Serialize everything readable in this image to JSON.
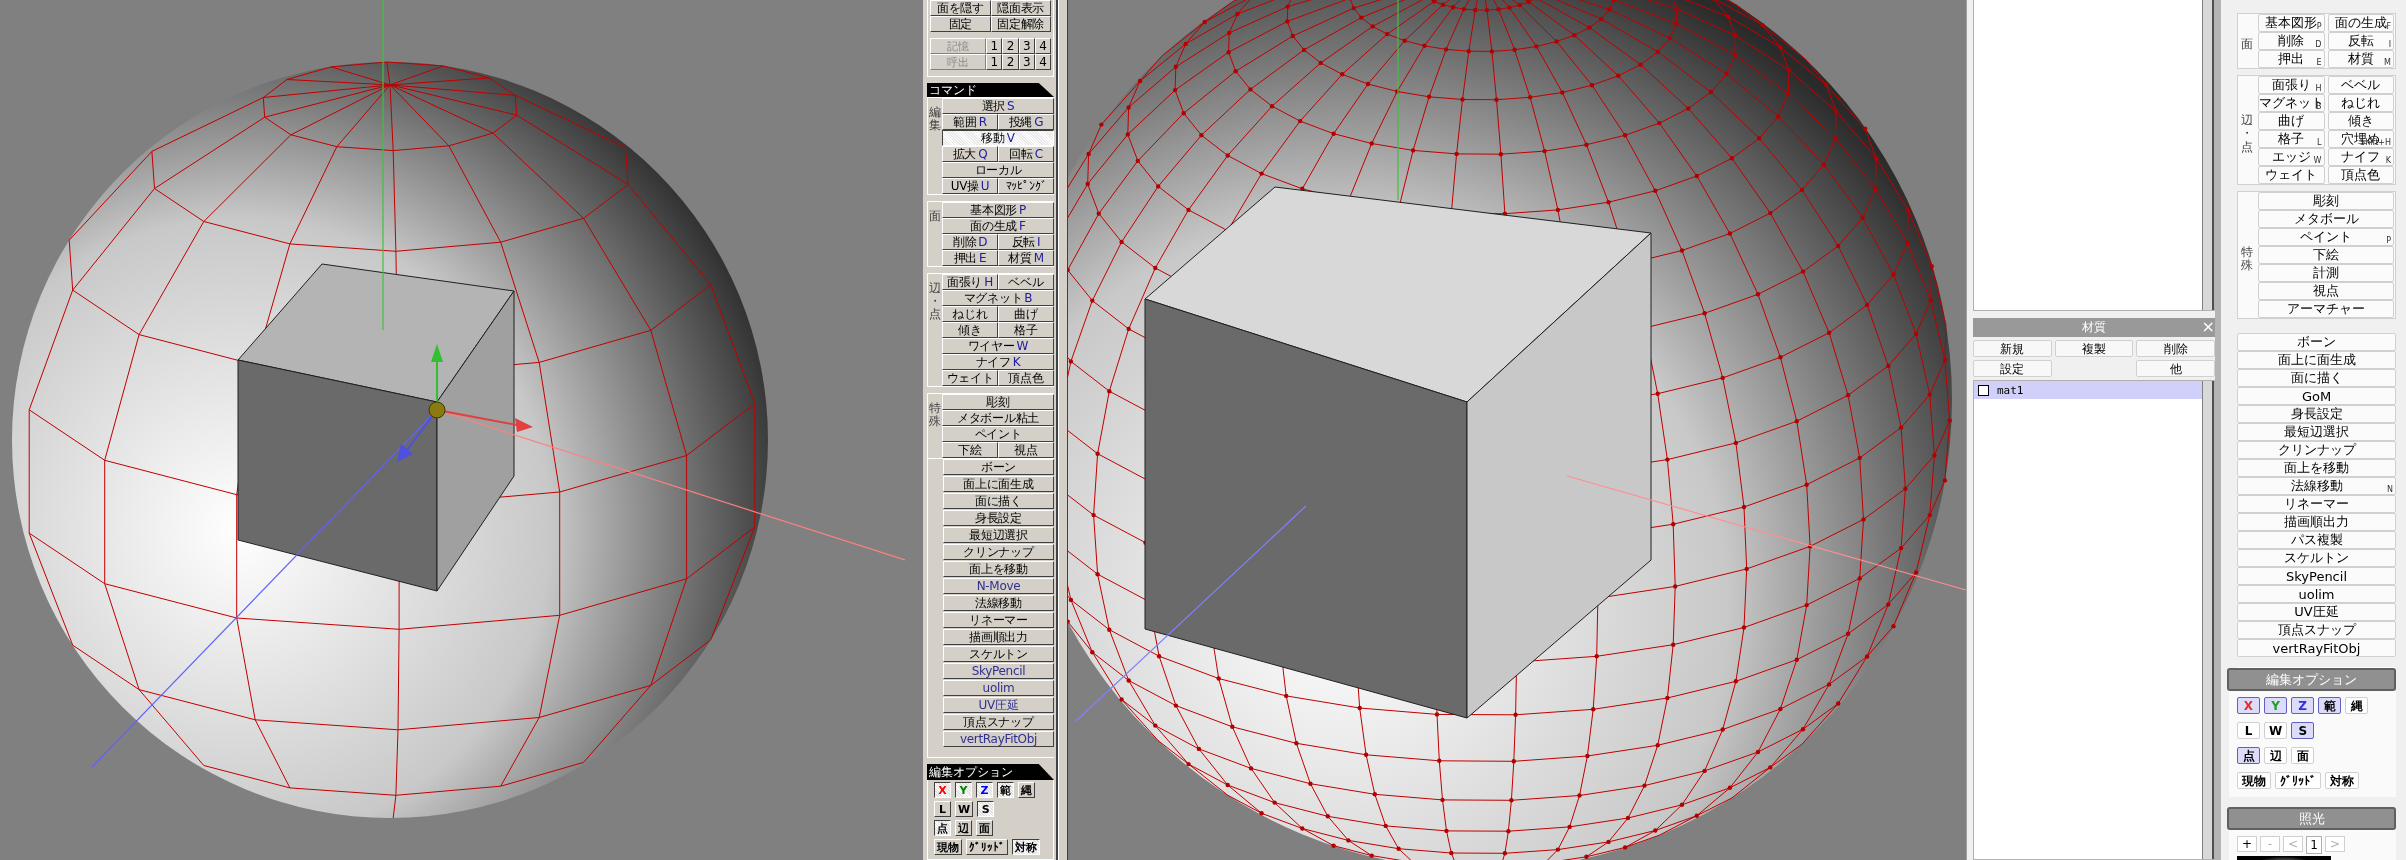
{
  "command_panel": {
    "top_buttons": [
      {
        "label": "面を隠す"
      },
      {
        "label": "隠面表示"
      },
      {
        "label": "固定"
      },
      {
        "label": "固定解除"
      }
    ],
    "memory_rows": [
      {
        "label": "記憶",
        "disabled": true,
        "slots": [
          "1",
          "2",
          "3",
          "4"
        ]
      },
      {
        "label": "呼出",
        "disabled": true,
        "slots": [
          "1",
          "2",
          "3",
          "4"
        ]
      }
    ],
    "title": "コマンド",
    "groups": [
      {
        "label": "編集",
        "rows": [
          [
            {
              "label": "選択",
              "key": "S",
              "selected": false
            }
          ],
          [
            {
              "label": "範囲",
              "key": "R",
              "selected": false
            },
            {
              "label": "投縄",
              "key": "G",
              "selected": false
            }
          ],
          [
            {
              "label": "移動",
              "key": "V",
              "selected": true
            }
          ],
          [
            {
              "label": "拡大",
              "key": "Q",
              "selected": false
            },
            {
              "label": "回転",
              "key": "C",
              "selected": false
            }
          ],
          [
            {
              "label": "ローカル",
              "selected": false
            }
          ],
          [
            {
              "label": "UV操",
              "key": "U",
              "selected": false
            },
            {
              "label": "ﾏｯﾋﾟﾝｸﾞ",
              "selected": false
            }
          ]
        ]
      },
      {
        "label": "面",
        "rows": [
          [
            {
              "label": "基本図形",
              "key": "P",
              "selected": false
            }
          ],
          [
            {
              "label": "面の生成",
              "key": "F",
              "selected": false
            }
          ],
          [
            {
              "label": "削除",
              "key": "D",
              "selected": false
            },
            {
              "label": "反転",
              "key": "I",
              "selected": false
            }
          ],
          [
            {
              "label": "押出",
              "key": "E",
              "selected": false
            },
            {
              "label": "材質",
              "key": "M",
              "selected": false
            }
          ]
        ]
      },
      {
        "label": "辺・点",
        "rows": [
          [
            {
              "label": "面張り",
              "key": "H",
              "selected": false
            },
            {
              "label": "ベベル",
              "selected": false
            }
          ],
          [
            {
              "label": "マグネット",
              "key": "B",
              "selected": false
            }
          ],
          [
            {
              "label": "ねじれ",
              "selected": false
            },
            {
              "label": "曲げ",
              "selected": false
            }
          ],
          [
            {
              "label": "傾き",
              "selected": false
            },
            {
              "label": "格子",
              "selected": false
            }
          ],
          [
            {
              "label": "ワイヤー",
              "key": "W",
              "selected": false
            }
          ],
          [
            {
              "label": "ナイフ",
              "key": "K",
              "selected": false
            }
          ],
          [
            {
              "label": "ウェイト",
              "selected": false
            },
            {
              "label": "頂点色",
              "selected": false
            }
          ]
        ]
      },
      {
        "label": "特殊",
        "rows": [
          [
            {
              "label": "彫刻",
              "selected": false
            }
          ],
          [
            {
              "label": "メタボール粘土",
              "selected": false
            }
          ],
          [
            {
              "label": "ペイント",
              "selected": false
            }
          ],
          [
            {
              "label": "下絵",
              "selected": false
            },
            {
              "label": "視点",
              "selected": false
            }
          ]
        ]
      }
    ],
    "extras": [
      {
        "label": "ボーン",
        "kind": "builtin"
      },
      {
        "label": "面上に面生成",
        "kind": "builtin"
      },
      {
        "label": "面に描く",
        "kind": "builtin"
      },
      {
        "label": "身長設定",
        "kind": "builtin"
      },
      {
        "label": "最短辺選択",
        "kind": "builtin"
      },
      {
        "label": "クリンナップ",
        "kind": "builtin"
      },
      {
        "label": "面上を移動",
        "kind": "builtin"
      },
      {
        "label": "N-Move",
        "kind": "plugin"
      },
      {
        "label": "法線移動",
        "kind": "builtin"
      },
      {
        "label": "リネーマー",
        "kind": "builtin"
      },
      {
        "label": "描画順出力",
        "kind": "builtin"
      },
      {
        "label": "スケルトン",
        "kind": "builtin"
      },
      {
        "label": "SkyPencil",
        "kind": "plugin"
      },
      {
        "label": "uolim",
        "kind": "plugin"
      },
      {
        "label": "UV圧延",
        "kind": "plugin"
      },
      {
        "label": "頂点スナップ",
        "kind": "builtin"
      },
      {
        "label": "vertRayFitObj",
        "kind": "plugin"
      }
    ],
    "options": {
      "title": "編集オプション",
      "lines": [
        {
          "toggles": [
            {
              "label": "X",
              "color": "#ff0000",
              "selected": true
            },
            {
              "label": "Y",
              "color": "#008000",
              "selected": true
            },
            {
              "label": "Z",
              "color": "#0000ff",
              "selected": true
            },
            {
              "label": "範",
              "selected": true
            },
            {
              "label": "縄",
              "selected": false
            }
          ]
        },
        {
          "toggles": [
            {
              "label": "L",
              "selected": false
            },
            {
              "label": "W",
              "selected": false
            },
            {
              "label": "S",
              "selected": true
            }
          ]
        },
        {
          "toggles": [
            {
              "label": "点",
              "selected": true
            },
            {
              "label": "辺",
              "selected": false
            },
            {
              "label": "面",
              "selected": false
            }
          ]
        },
        {
          "toggles": [
            {
              "label": "現物",
              "selected": false
            },
            {
              "label": "ｸﾞﾘｯﾄﾞ",
              "selected": false
            },
            {
              "label": "対称",
              "selected": true
            }
          ]
        }
      ]
    }
  },
  "material_panel": {
    "title": "材質",
    "close": "×",
    "buttons": [
      {
        "kind": "button",
        "label": "新規"
      },
      {
        "kind": "button",
        "label": "複製"
      },
      {
        "kind": "button",
        "label": "削除"
      },
      {
        "kind": "button",
        "label": "設定"
      },
      {
        "kind": "gap"
      },
      {
        "kind": "button",
        "label": "他"
      }
    ],
    "materials": [
      {
        "name": "mat1",
        "checked": false,
        "selected": true
      }
    ]
  },
  "side_panel": {
    "groups": [
      {
        "label": "面",
        "rows": [
          [
            {
              "label": "基本図形",
              "key": "P",
              "selected": false
            },
            {
              "label": "面の生成",
              "key": "F",
              "selected": false
            }
          ],
          [
            {
              "label": "削除",
              "key": "D",
              "selected": false
            },
            {
              "label": "反転",
              "key": "I",
              "selected": false
            }
          ],
          [
            {
              "label": "押出",
              "key": "E",
              "selected": false
            },
            {
              "label": "材質",
              "key": "M",
              "selected": false
            }
          ]
        ]
      },
      {
        "label": "辺・点",
        "rows": [
          [
            {
              "label": "面張り",
              "key": "H",
              "selected": false
            },
            {
              "label": "ベベル",
              "selected": false
            }
          ],
          [
            {
              "label": "マグネット",
              "key": "B",
              "selected": false
            },
            {
              "label": "ねじれ",
              "selected": false
            }
          ],
          [
            {
              "label": "曲げ",
              "selected": false
            },
            {
              "label": "傾き",
              "selected": false
            }
          ],
          [
            {
              "label": "格子",
              "key": "L",
              "selected": false
            },
            {
              "label": "穴埋め",
              "key": "Shift+H",
              "selected": false
            }
          ],
          [
            {
              "label": "エッジ",
              "key": "W",
              "selected": false
            },
            {
              "label": "ナイフ",
              "key": "K",
              "selected": false
            }
          ],
          [
            {
              "label": "ウェイト",
              "selected": false
            },
            {
              "label": "頂点色",
              "selected": false
            }
          ]
        ]
      },
      {
        "label": "特殊",
        "rows": [
          [
            {
              "label": "彫刻",
              "selected": false
            }
          ],
          [
            {
              "label": "メタボール",
              "selected": false
            }
          ],
          [
            {
              "label": "ペイント",
              "key": "P",
              "selected": false
            }
          ],
          [
            {
              "label": "下絵",
              "selected": false
            }
          ],
          [
            {
              "label": "計測",
              "selected": false
            }
          ],
          [
            {
              "label": "視点",
              "selected": false
            }
          ],
          [
            {
              "label": "アーマチャー",
              "selected": false
            }
          ]
        ]
      }
    ],
    "extras": [
      {
        "label": "ボーン"
      },
      {
        "label": "面上に面生成"
      },
      {
        "label": "面に描く"
      },
      {
        "label": "GoM"
      },
      {
        "label": "身長設定"
      },
      {
        "label": "最短辺選択"
      },
      {
        "label": "クリンナップ"
      },
      {
        "label": "面上を移動"
      },
      {
        "label": "法線移動",
        "key": "N"
      },
      {
        "label": "リネーマー"
      },
      {
        "label": "描画順出力"
      },
      {
        "label": "パス複製"
      },
      {
        "label": "スケルトン"
      },
      {
        "label": "SkyPencil"
      },
      {
        "label": "uolim"
      },
      {
        "label": "UV圧延"
      },
      {
        "label": "頂点スナップ"
      },
      {
        "label": "vertRayFitObj"
      }
    ],
    "options": {
      "title": "編集オプション",
      "lines": [
        {
          "toggles": [
            {
              "label": "X",
              "color": "#e03030",
              "selected": true
            },
            {
              "label": "Y",
              "color": "#20a020",
              "selected": true
            },
            {
              "label": "Z",
              "color": "#3030e0",
              "selected": true
            },
            {
              "label": "範",
              "selected": true
            },
            {
              "label": "縄",
              "selected": false
            }
          ]
        },
        {
          "toggles": [
            {
              "label": "L",
              "selected": false
            },
            {
              "label": "W",
              "selected": false
            },
            {
              "label": "S",
              "selected": true
            }
          ]
        },
        {
          "toggles": [
            {
              "label": "点",
              "selected": true
            },
            {
              "label": "辺",
              "selected": false
            },
            {
              "label": "面",
              "selected": false
            }
          ]
        },
        {
          "toggles": [
            {
              "label": "現物",
              "selected": false
            },
            {
              "label": "ｸﾞﾘｯﾄﾞ",
              "selected": false
            },
            {
              "label": "対称",
              "selected": false
            }
          ]
        }
      ]
    },
    "lighting": {
      "title": "照光",
      "buttons": [
        {
          "kind": "button",
          "label": "+",
          "disabled": false
        },
        {
          "kind": "button",
          "label": "-",
          "disabled": true
        },
        {
          "kind": "button",
          "label": "<",
          "disabled": true
        },
        {
          "kind": "field",
          "label": "1",
          "disabled": false
        },
        {
          "kind": "button",
          "label": ">",
          "disabled": true
        }
      ]
    }
  }
}
